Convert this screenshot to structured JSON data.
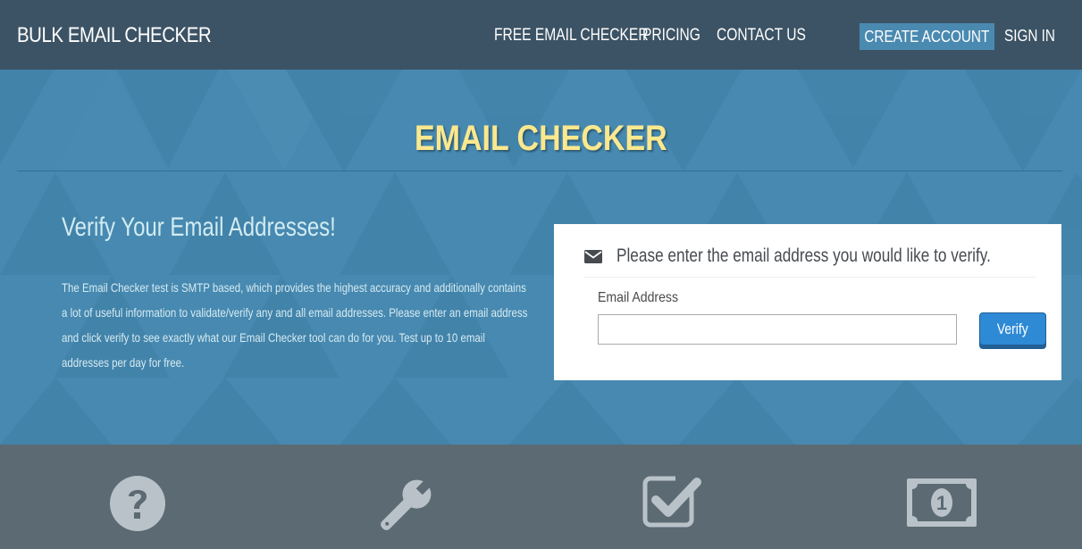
{
  "header": {
    "brand": "BULK EMAIL CHECKER",
    "nav": [
      {
        "label": "FREE EMAIL CHECKER"
      },
      {
        "label": "PRICING"
      },
      {
        "label": "CONTACT US"
      }
    ],
    "create_account": "CREATE ACCOUNT",
    "sign_in": "SIGN IN"
  },
  "hero": {
    "title": "EMAIL CHECKER",
    "subtitle": "Verify Your Email Addresses!",
    "description": "The Email Checker test is SMTP based, which provides the highest accuracy and additionally contains a lot of useful information to validate/verify any and all email addresses. Please enter an email address and click verify to see exactly what our Email Checker tool can do for you. Test up to 10 email addresses per day for free."
  },
  "verify_form": {
    "heading": "Please enter the email address you would like to verify.",
    "heading_icon": "envelope-icon",
    "field_label": "Email Address",
    "email_value": "",
    "email_placeholder": "",
    "button_label": "Verify"
  },
  "features": {
    "icons": [
      "question-circle-icon",
      "wrench-icon",
      "checkbox-checked-icon",
      "money-bill-icon"
    ]
  },
  "colors": {
    "topbar": "#3c5365",
    "hero": "#4789b0",
    "title": "#fbe88e",
    "accent_button": "#2f8ad6",
    "create_account_bg": "#4b8ab0",
    "features_bg": "#5c6a73",
    "feature_icon": "#b9c2c9"
  }
}
